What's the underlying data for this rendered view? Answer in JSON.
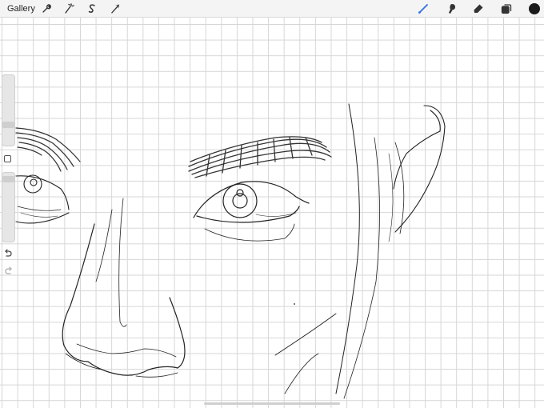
{
  "toolbar": {
    "gallery_label": "Gallery",
    "left_tools": [
      {
        "name": "actions-wrench-icon"
      },
      {
        "name": "adjustments-wand-icon"
      },
      {
        "name": "selection-s-icon"
      },
      {
        "name": "transform-arrow-icon"
      }
    ],
    "right_tools": [
      {
        "name": "brush-icon",
        "active": true
      },
      {
        "name": "smudge-icon"
      },
      {
        "name": "eraser-icon"
      },
      {
        "name": "layers-icon"
      },
      {
        "name": "color-swatch-icon"
      }
    ],
    "accent_color": "#2f6fe0",
    "current_color": "#1a1a1a"
  },
  "sidebar": {
    "controls": [
      "brush-size-slider",
      "modify-button",
      "opacity-slider",
      "undo-icon",
      "redo-icon"
    ]
  },
  "canvas": {
    "background": "#ffffff",
    "grid_color": "#d6d6d6",
    "content": "line-drawing-face-sketch"
  }
}
